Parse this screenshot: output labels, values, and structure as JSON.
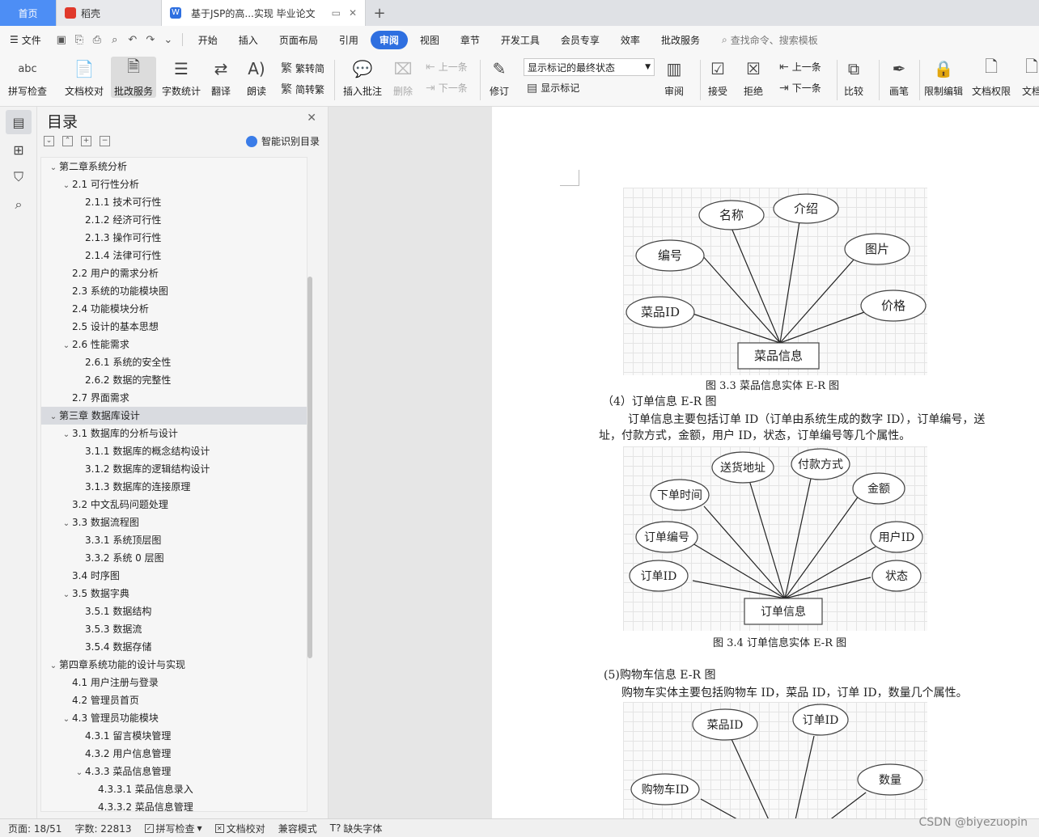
{
  "tabs": {
    "home": "首页",
    "daoke": "稻壳",
    "doc_title": "基于JSP的高...实现 毕业论文",
    "add": "+"
  },
  "menu": {
    "file": "文件",
    "items": [
      "开始",
      "插入",
      "页面布局",
      "引用",
      "审阅",
      "视图",
      "章节",
      "开发工具",
      "会员专享",
      "效率",
      "批改服务"
    ],
    "active_index": 4,
    "search": "查找命令、搜索模板"
  },
  "ribbon": {
    "spell": "拼写检查",
    "proof": "文档校对",
    "correct": "批改服务",
    "wordcount": "字数统计",
    "translate": "翻译",
    "read": "朗读",
    "trad": "繁转简",
    "simp": "简转繁",
    "insert_comment": "插入批注",
    "delete": "删除",
    "prev_comment": "上一条",
    "next_comment": "下一条",
    "revise": "修订",
    "markup_select": "显示标记的最终状态",
    "show_markup": "显示标记",
    "review": "审阅",
    "accept": "接受",
    "reject": "拒绝",
    "prev_change": "上一条",
    "next_change": "下一条",
    "compare": "比较",
    "pen": "画笔",
    "restrict": "限制编辑",
    "permission": "文档权限",
    "more": "文档"
  },
  "toc": {
    "title": "目录",
    "smart": "智能识别目录",
    "items": [
      {
        "text": "第二章系统分析",
        "level": 0,
        "caret": "v"
      },
      {
        "text": "2.1 可行性分析",
        "level": 1,
        "caret": "v"
      },
      {
        "text": "2.1.1 技术可行性",
        "level": 2,
        "caret": ""
      },
      {
        "text": "2.1.2 经济可行性",
        "level": 2,
        "caret": ""
      },
      {
        "text": "2.1.3 操作可行性",
        "level": 2,
        "caret": ""
      },
      {
        "text": "2.1.4 法律可行性",
        "level": 2,
        "caret": ""
      },
      {
        "text": "2.2 用户的需求分析",
        "level": 1,
        "caret": ""
      },
      {
        "text": "2.3 系统的功能模块图",
        "level": 1,
        "caret": ""
      },
      {
        "text": "2.4 功能模块分析",
        "level": 1,
        "caret": ""
      },
      {
        "text": "2.5 设计的基本思想",
        "level": 1,
        "caret": ""
      },
      {
        "text": "2.6 性能需求",
        "level": 1,
        "caret": "v"
      },
      {
        "text": "2.6.1 系统的安全性",
        "level": 2,
        "caret": ""
      },
      {
        "text": "2.6.2 数据的完整性",
        "level": 2,
        "caret": ""
      },
      {
        "text": "2.7 界面需求",
        "level": 1,
        "caret": ""
      },
      {
        "text": "第三章 数据库设计",
        "level": 0,
        "caret": "v",
        "selected": true
      },
      {
        "text": "3.1 数据库的分析与设计",
        "level": 1,
        "caret": "v"
      },
      {
        "text": "3.1.1 数据库的概念结构设计",
        "level": 2,
        "caret": ""
      },
      {
        "text": "3.1.2 数据库的逻辑结构设计",
        "level": 2,
        "caret": ""
      },
      {
        "text": "3.1.3 数据库的连接原理",
        "level": 2,
        "caret": ""
      },
      {
        "text": "3.2 中文乱码问题处理",
        "level": 1,
        "caret": ""
      },
      {
        "text": "3.3 数据流程图",
        "level": 1,
        "caret": "v"
      },
      {
        "text": "3.3.1 系统顶层图",
        "level": 2,
        "caret": ""
      },
      {
        "text": "3.3.2 系统 0 层图",
        "level": 2,
        "caret": ""
      },
      {
        "text": "3.4 时序图",
        "level": 1,
        "caret": ""
      },
      {
        "text": "3.5  数据字典",
        "level": 1,
        "caret": "v"
      },
      {
        "text": "3.5.1  数据结构",
        "level": 2,
        "caret": ""
      },
      {
        "text": "3.5.3  数据流",
        "level": 2,
        "caret": ""
      },
      {
        "text": "3.5.4 数据存储",
        "level": 2,
        "caret": ""
      },
      {
        "text": "第四章系统功能的设计与实现",
        "level": 0,
        "caret": "v"
      },
      {
        "text": "4.1 用户注册与登录",
        "level": 1,
        "caret": ""
      },
      {
        "text": "4.2 管理员首页",
        "level": 1,
        "caret": ""
      },
      {
        "text": "4.3 管理员功能模块",
        "level": 1,
        "caret": "v"
      },
      {
        "text": "4.3.1 留言模块管理",
        "level": 2,
        "caret": ""
      },
      {
        "text": "4.3.2 用户信息管理",
        "level": 2,
        "caret": ""
      },
      {
        "text": "4.3.3 菜品信息管理",
        "level": 2,
        "caret": "v"
      },
      {
        "text": "4.3.3.1 菜品信息录入",
        "level": 3,
        "caret": ""
      },
      {
        "text": "4.3.3.2 菜品信息管理",
        "level": 3,
        "caret": ""
      }
    ]
  },
  "document": {
    "er1": {
      "entity": "菜品信息",
      "attrs": [
        "名称",
        "介绍",
        "编号",
        "图片",
        "菜品ID",
        "价格"
      ],
      "caption": "图 3.3 菜品信息实体 E-R 图"
    },
    "section4_heading": "（4）订单信息 E-R 图",
    "section4_line1": "订单信息主要包括订单 ID（订单由系统生成的数字 ID），订单编号，送",
    "section4_line2": "址，付款方式，金额，用户 ID，状态，订单编号等几个属性。",
    "er2": {
      "entity": "订单信息",
      "attrs": [
        "送货地址",
        "付款方式",
        "下单时间",
        "金额",
        "订单编号",
        "用户ID",
        "订单ID",
        "状态"
      ],
      "caption": "图 3.4 订单信息实体 E-R 图"
    },
    "section5_heading": "(5)购物车信息 E-R 图",
    "section5_line1": "购物车实体主要包括购物车 ID，菜品 ID，订单 ID，数量几个属性。",
    "er3": {
      "attrs": [
        "菜品ID",
        "订单ID",
        "购物车ID",
        "数量"
      ]
    }
  },
  "status": {
    "page": "页面: 18/51",
    "words": "字数: 22813",
    "spell": "拼写检查",
    "proof": "文档校对",
    "compat": "兼容模式",
    "missing_font": "缺失字体"
  },
  "watermark": "CSDN @biyezuopin"
}
